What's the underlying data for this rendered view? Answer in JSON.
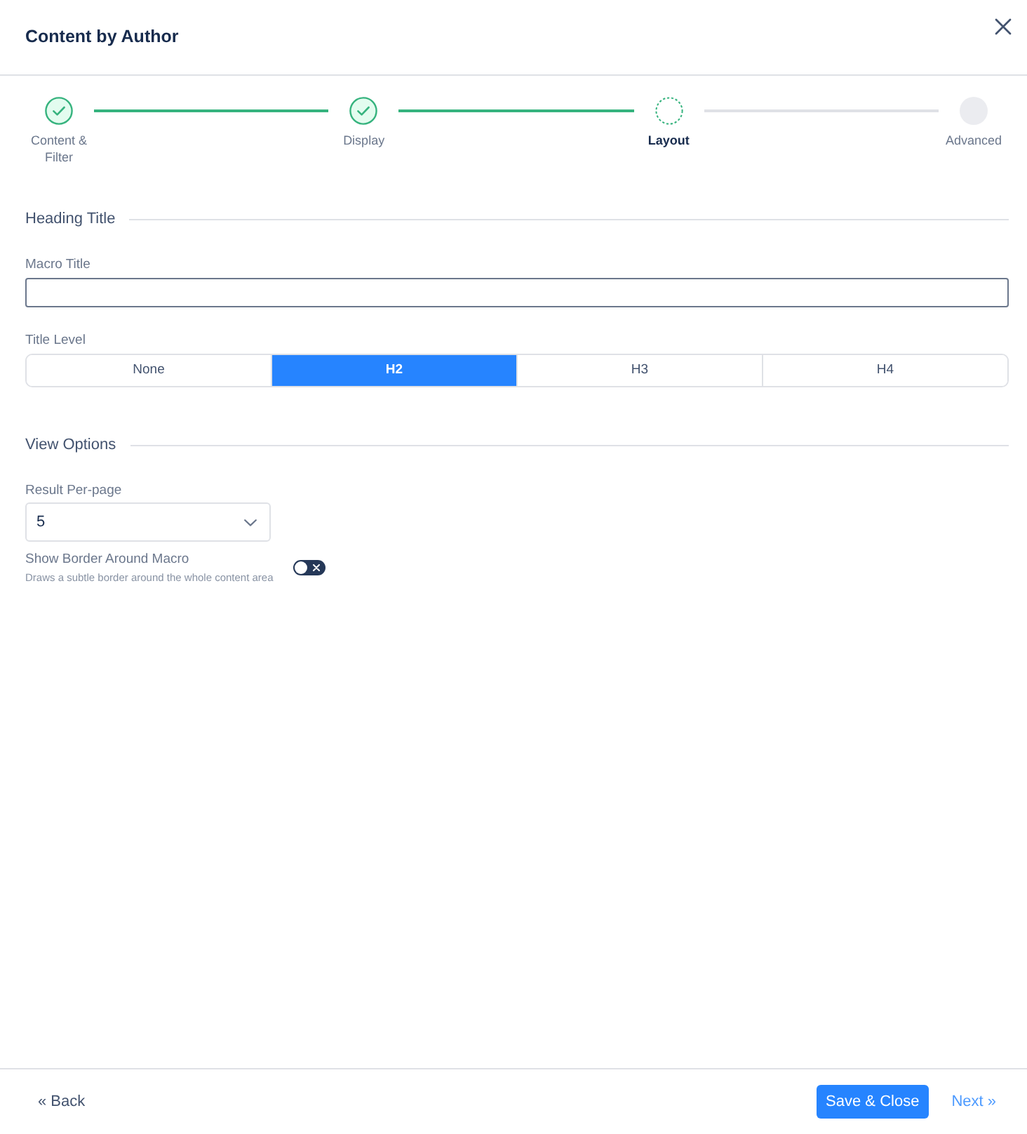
{
  "dialog": {
    "title": "Content by Author"
  },
  "steps": [
    {
      "label": "Content & Filter",
      "completed": true,
      "selected": false
    },
    {
      "label": "Display",
      "completed": true,
      "selected": false
    },
    {
      "label": "Layout",
      "completed": false,
      "selected": true
    },
    {
      "label": "Advanced",
      "completed": false,
      "selected": false
    }
  ],
  "sections": [
    {
      "title": "Heading Title",
      "fields": [
        {
          "kind": "text",
          "label": "Macro Title"
        },
        {
          "kind": "segmented",
          "label": "Title Level",
          "options": [
            {
              "label": "None",
              "selected": false
            },
            {
              "label": "H2",
              "selected": true
            },
            {
              "label": "H3",
              "selected": false
            },
            {
              "label": "H4",
              "selected": false
            }
          ]
        }
      ]
    },
    {
      "title": "View Options",
      "fields": [
        {
          "kind": "select",
          "label": "Result Per-page",
          "value": "5"
        },
        {
          "kind": "toggle",
          "label": "Show Border Around Macro",
          "description": "Draws a subtle border around the whole content area",
          "on": false
        }
      ]
    }
  ],
  "footer": {
    "back": "« Back",
    "save": "Save & Close",
    "next": "Next »"
  }
}
